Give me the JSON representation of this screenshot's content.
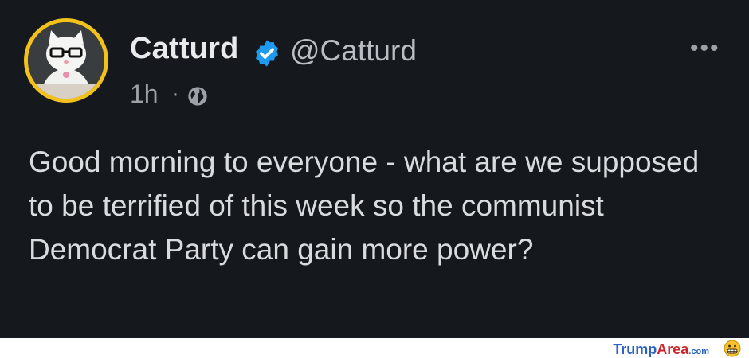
{
  "tweet": {
    "display_name": "Catturd",
    "handle": "@Catturd",
    "time": "1h",
    "separator": "·",
    "more_icon": "more-horizontal-icon",
    "text": "Good morning to everyone - what are we supposed to be terrified of this week so the communist Democrat Party can gain more power?"
  },
  "footer": {
    "brand_part1": "Trump",
    "brand_part2": "Area",
    "brand_part3": ".com"
  },
  "colors": {
    "background": "#15181c",
    "verified_blue": "#1d9bf0",
    "avatar_ring": "#f2c21b"
  }
}
